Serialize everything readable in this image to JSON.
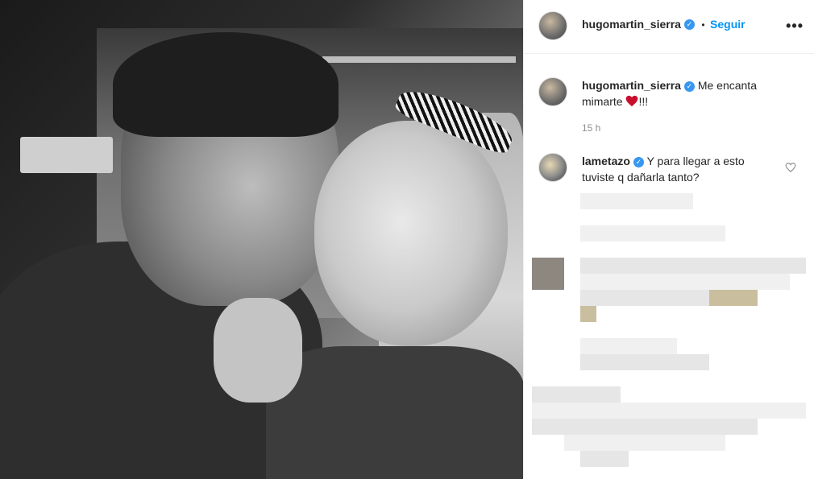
{
  "post": {
    "owner": {
      "username": "hugomartin_sierra",
      "verified": true,
      "separator": "•",
      "follow_label": "Seguir",
      "more_icon": "more-options-icon"
    },
    "caption": {
      "username": "hugomartin_sierra",
      "text": "Me encanta mimarte",
      "emoji": "heart-emoji",
      "suffix": "!!!",
      "time": "15 h"
    },
    "comments": [
      {
        "username": "lametazo",
        "verified": true,
        "text": "Y para llegar a esto tuviste q dañarla tanto?",
        "like_icon": "heart-outline-icon"
      }
    ]
  },
  "colors": {
    "accent": "#0095f6",
    "verified": "#3897f0",
    "heart": "#ed4956",
    "muted_text": "#8e8e8e"
  }
}
